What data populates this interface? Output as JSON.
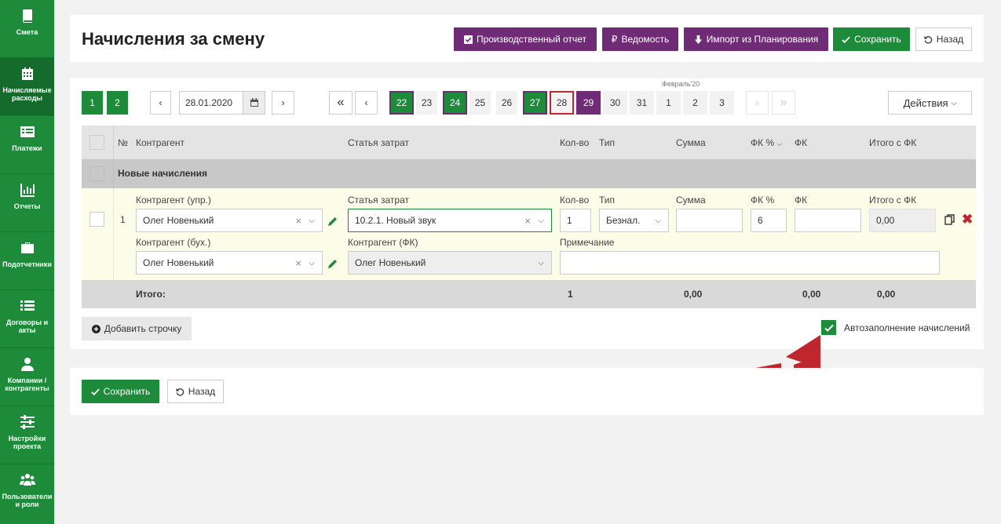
{
  "sidebar": {
    "items": [
      {
        "label": "Смета",
        "icon": "book-icon"
      },
      {
        "label": "Начисляемые расходы",
        "icon": "calendar-icon"
      },
      {
        "label": "Платежи",
        "icon": "list-alt-icon"
      },
      {
        "label": "Отчеты",
        "icon": "bar-chart-icon"
      },
      {
        "label": "Подотчетники",
        "icon": "briefcase-icon"
      },
      {
        "label": "Договоры и акты",
        "icon": "list-icon"
      },
      {
        "label": "Компании / контрагенты",
        "icon": "user-icon"
      },
      {
        "label": "Настройки проекта",
        "icon": "sliders-icon"
      },
      {
        "label": "Пользователи и роли",
        "icon": "users-icon"
      }
    ]
  },
  "header": {
    "title": "Начисления за смену",
    "buttons": {
      "production_report": "Производственный отчет",
      "statement": "Ведомость",
      "import": "Импорт из Планирования",
      "save": "Сохранить",
      "back": "Назад"
    }
  },
  "calendar": {
    "page1": "1",
    "page2": "2",
    "prev": "‹",
    "next": "›",
    "first": "«",
    "last": "»",
    "date_value": "28.01.2020",
    "month_label": "Февраль'20",
    "days": [
      "22",
      "23",
      "24",
      "25",
      "26",
      "27",
      "28",
      "29",
      "30",
      "31",
      "1",
      "2",
      "3"
    ],
    "actions": "Действия"
  },
  "table": {
    "headers": {
      "num": "№",
      "contractor": "Контрагент",
      "cost_item": "Статья затрат",
      "qty": "Кол-во",
      "type": "Тип",
      "sum": "Сумма",
      "fk_pct": "ФК %",
      "fk": "ФК",
      "total_fk": "Итого с ФК"
    },
    "group_label": "Новые начисления",
    "row": {
      "num": "1",
      "labels": {
        "contractor_mgmt": "Контрагент (упр.)",
        "cost_item": "Статья затрат",
        "qty": "Кол-во",
        "type": "Тип",
        "sum": "Сумма",
        "fk_pct": "ФК %",
        "fk": "ФК",
        "total_fk": "Итого с ФК",
        "contractor_acc": "Контрагент (бух.)",
        "contractor_fk": "Контрагент (ФК)",
        "note": "Примечание"
      },
      "values": {
        "contractor_mgmt": "Олег Новенький",
        "cost_item": "10.2.1. Новый звук",
        "qty": "1",
        "type": "Безнал.",
        "sum": "",
        "fk_pct": "6",
        "fk": "",
        "total_fk": "0,00",
        "contractor_acc": "Олег Новенький",
        "contractor_fk": "Олег Новенький",
        "note": ""
      }
    },
    "totals": {
      "label": "Итого:",
      "qty": "1",
      "sum": "0,00",
      "fk": "0,00",
      "total_fk": "0,00"
    }
  },
  "footer_actions": {
    "add_row": "Добавить строчку",
    "autofill": "Автозаполнение начислений",
    "autofill_checked": true,
    "save": "Сохранить",
    "back": "Назад"
  },
  "colors": {
    "green": "#1e8b3a",
    "purple": "#6f2b76",
    "red": "#c0262d"
  }
}
